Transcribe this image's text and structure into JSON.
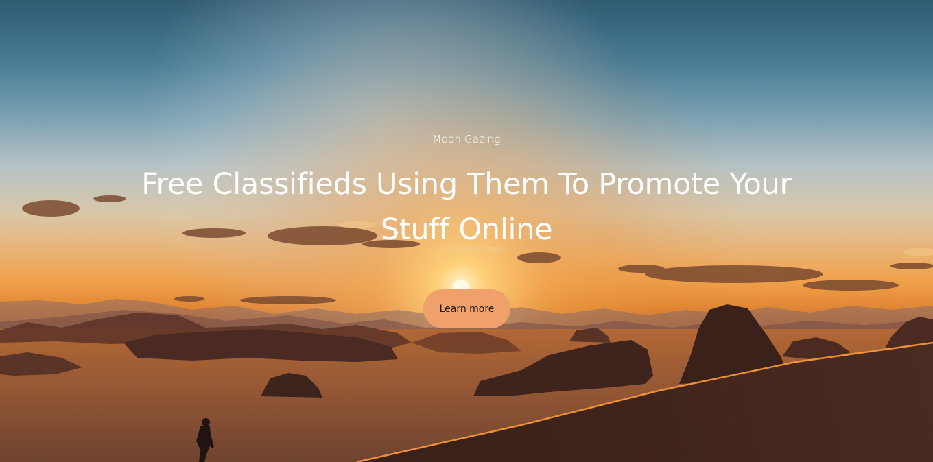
{
  "hero": {
    "eyebrow": "Moon Gazing",
    "headline": "Free Classifieds Using Them To Promote Your Stuff Online",
    "cta_label": "Learn more",
    "background_image": "desert-sunset-with-rock-formations-and-hiker",
    "colors": {
      "button": "#f0a06a",
      "button_text": "#1f1a16",
      "text": "#ffffff"
    }
  }
}
